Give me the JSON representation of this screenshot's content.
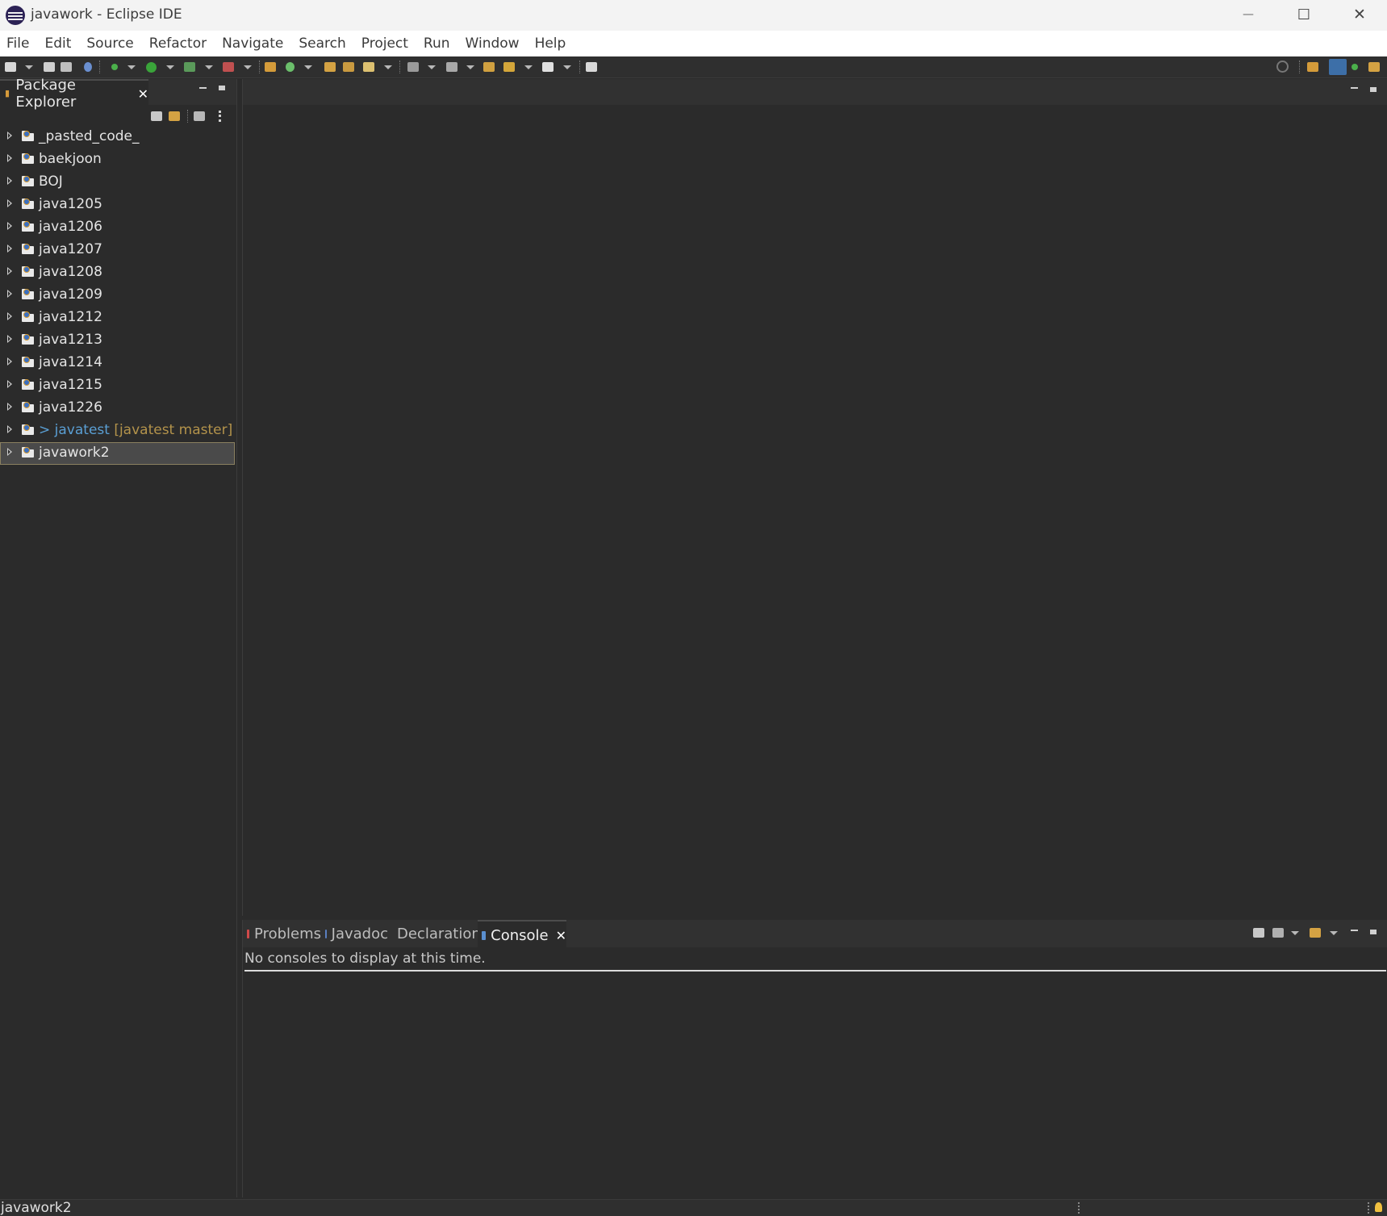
{
  "window": {
    "title": "javawork - Eclipse IDE",
    "minimize_glyph": "—",
    "maximize_glyph": "☐",
    "close_glyph": "✕"
  },
  "menu": [
    "File",
    "Edit",
    "Source",
    "Refactor",
    "Navigate",
    "Search",
    "Project",
    "Run",
    "Window",
    "Help"
  ],
  "package_explorer": {
    "tab_label": "Package Explorer",
    "close_glyph": "✕",
    "projects": [
      {
        "name": "_pasted_code_"
      },
      {
        "name": "baekjoon"
      },
      {
        "name": "BOJ"
      },
      {
        "name": "java1205"
      },
      {
        "name": "java1206"
      },
      {
        "name": "java1207"
      },
      {
        "name": "java1208"
      },
      {
        "name": "java1209"
      },
      {
        "name": "java1212"
      },
      {
        "name": "java1213"
      },
      {
        "name": "java1214"
      },
      {
        "name": "java1215"
      },
      {
        "name": "java1226"
      },
      {
        "name": "javatest",
        "git_prefix": "> ",
        "git_branch": "[javatest master]"
      },
      {
        "name": "javawork2",
        "selected": true
      }
    ]
  },
  "bottom_views": {
    "tabs": [
      {
        "label": "Problems",
        "icon": "problems-icon",
        "active": false
      },
      {
        "label": "Javadoc",
        "icon": "javadoc-icon",
        "active": false
      },
      {
        "label": "Declaration",
        "icon": "declaration-icon",
        "active": false
      },
      {
        "label": "Console",
        "icon": "console-icon",
        "active": true
      }
    ],
    "close_glyph": "✕",
    "console_message": "No consoles to display at this time."
  },
  "status_bar": {
    "text": "javawork2"
  },
  "colors": {
    "background": "#2b2b2b",
    "titlebar": "#f3f3f3",
    "menubar": "#ffffff",
    "git_prefix": "#5a9fd4",
    "git_branch": "#b3934b"
  }
}
